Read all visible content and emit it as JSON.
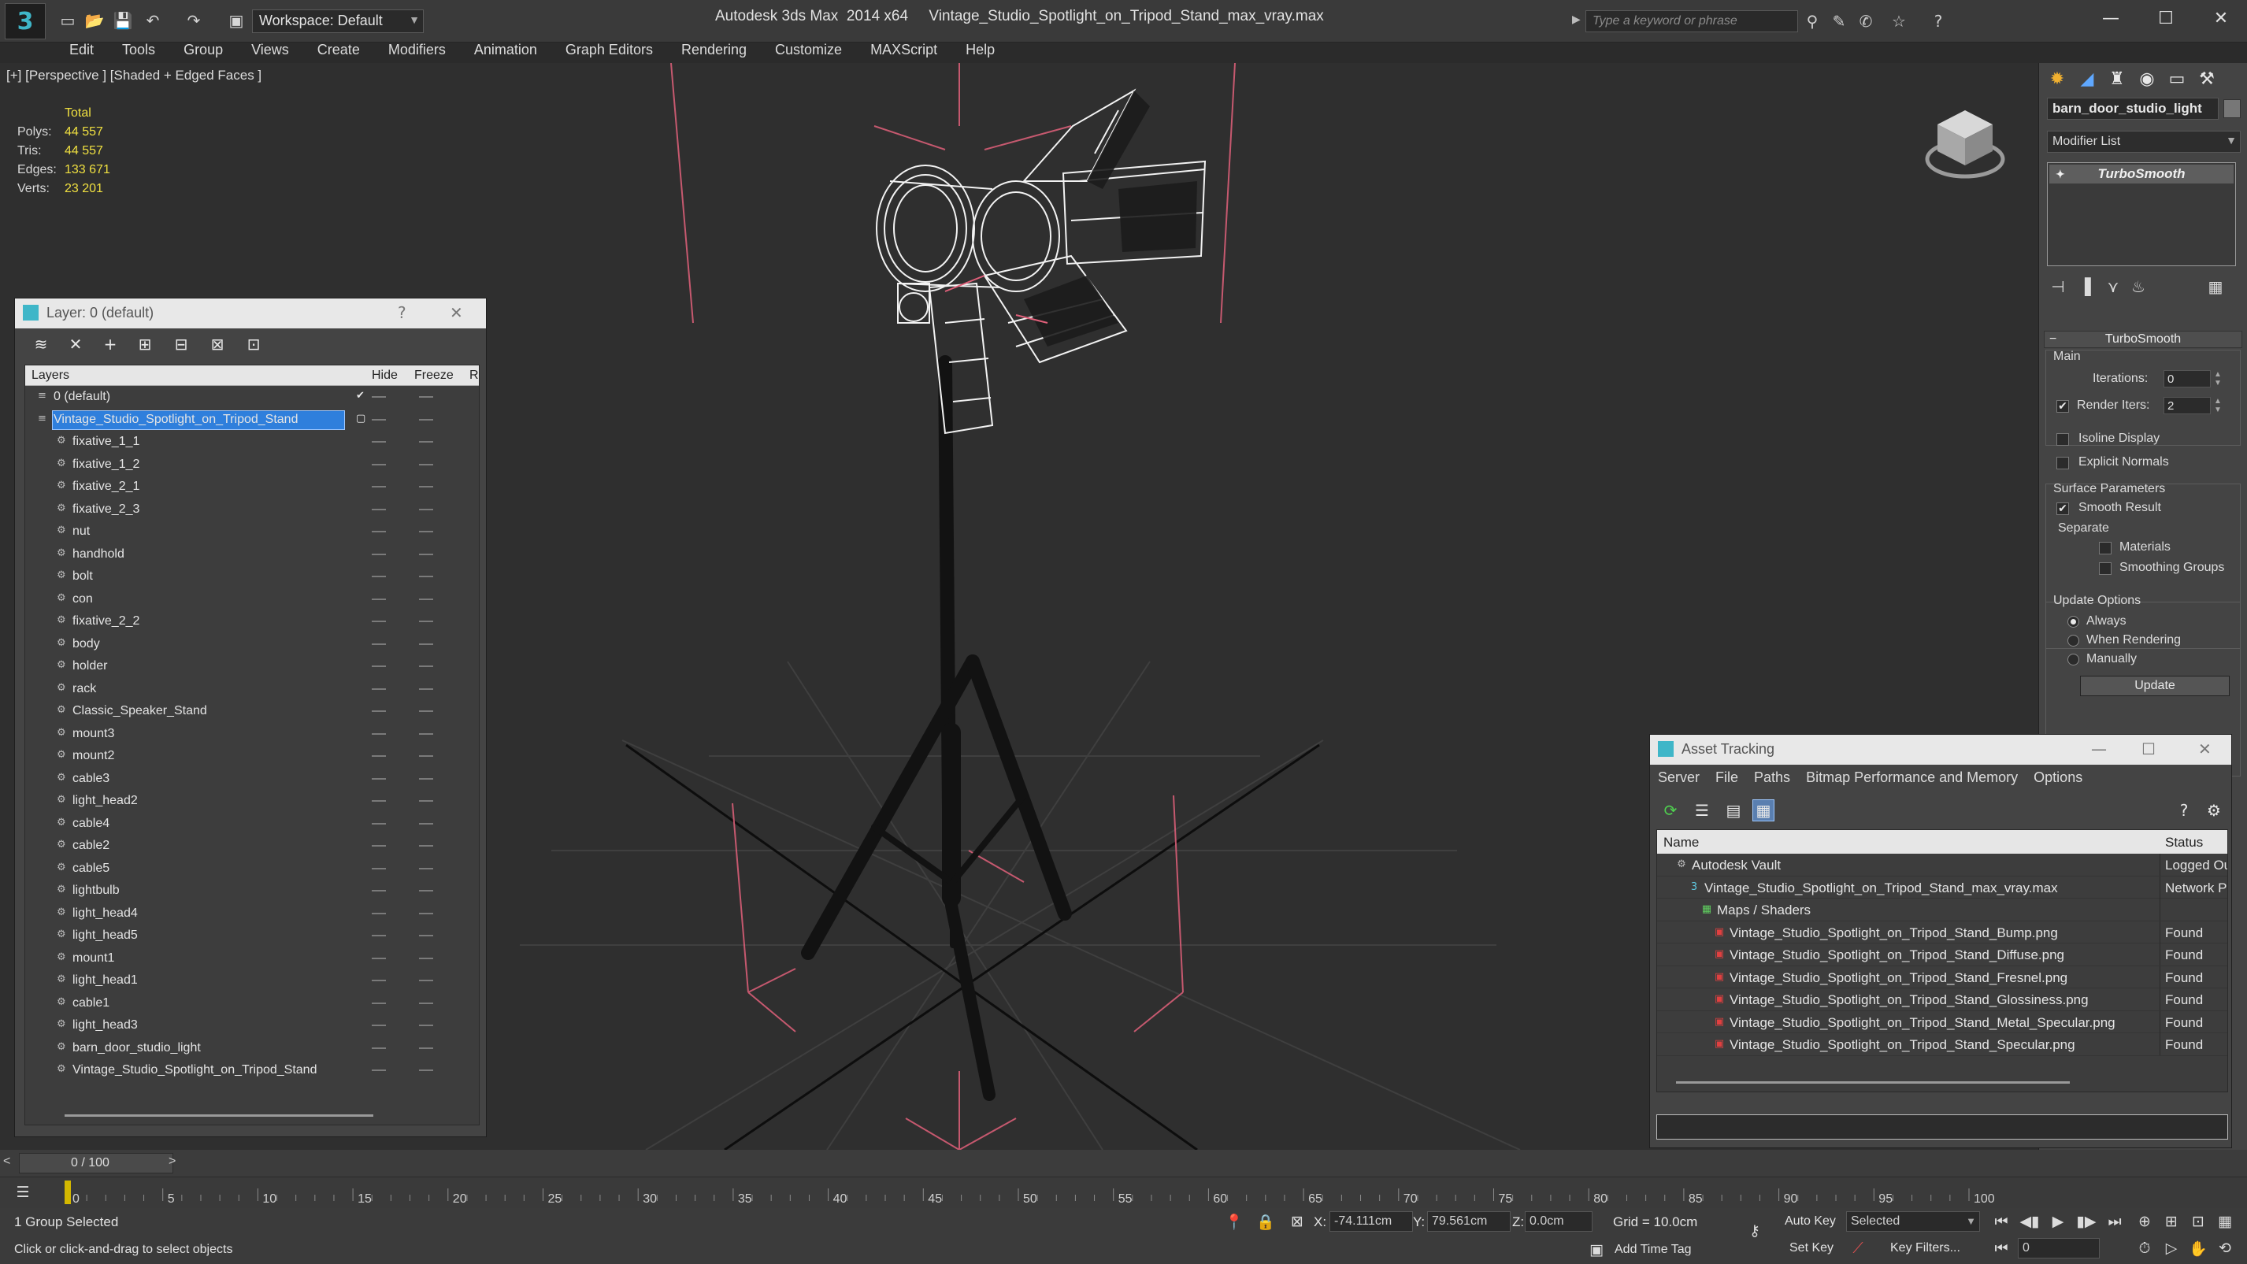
{
  "titlebar": {
    "workspace": "Workspace: Default",
    "app_title": "Autodesk 3ds Max  2014 x64     Vintage_Studio_Spotlight_on_Tripod_Stand_max_vray.max",
    "search_placeholder": "Type a keyword or phrase"
  },
  "menu": [
    "Edit",
    "Tools",
    "Group",
    "Views",
    "Create",
    "Modifiers",
    "Animation",
    "Graph Editors",
    "Rendering",
    "Customize",
    "MAXScript",
    "Help"
  ],
  "viewport": {
    "label": "[+] [Perspective ] [Shaded + Edged Faces ]",
    "stats": {
      "header": "Total",
      "polys_label": "Polys:",
      "polys": "44 557",
      "tris_label": "Tris:",
      "tris": "44 557",
      "edges_label": "Edges:",
      "edges": "133 671",
      "verts_label": "Verts:",
      "verts": "23 201"
    }
  },
  "layer_dialog": {
    "title": "Layer: 0 (default)",
    "help": "?",
    "close": "✕",
    "col_layers": "Layers",
    "col_hide": "Hide",
    "col_freeze": "Freeze",
    "col_more": "R",
    "rows": [
      {
        "name": "0 (default)",
        "level": 0,
        "type": "layer",
        "active": true
      },
      {
        "name": "Vintage_Studio_Spotlight_on_Tripod_Stand",
        "level": 0,
        "type": "layer",
        "selected": true
      },
      {
        "name": "fixative_1_1",
        "level": 1,
        "type": "object"
      },
      {
        "name": "fixative_1_2",
        "level": 1,
        "type": "object"
      },
      {
        "name": "fixative_2_1",
        "level": 1,
        "type": "object"
      },
      {
        "name": "fixative_2_3",
        "level": 1,
        "type": "object"
      },
      {
        "name": "nut",
        "level": 1,
        "type": "object"
      },
      {
        "name": "handhold",
        "level": 1,
        "type": "object"
      },
      {
        "name": "bolt",
        "level": 1,
        "type": "object"
      },
      {
        "name": "con",
        "level": 1,
        "type": "object"
      },
      {
        "name": "fixative_2_2",
        "level": 1,
        "type": "object"
      },
      {
        "name": "body",
        "level": 1,
        "type": "object"
      },
      {
        "name": "holder",
        "level": 1,
        "type": "object"
      },
      {
        "name": "rack",
        "level": 1,
        "type": "object"
      },
      {
        "name": "Classic_Speaker_Stand",
        "level": 1,
        "type": "object"
      },
      {
        "name": "mount3",
        "level": 1,
        "type": "object"
      },
      {
        "name": "mount2",
        "level": 1,
        "type": "object"
      },
      {
        "name": "cable3",
        "level": 1,
        "type": "object"
      },
      {
        "name": "light_head2",
        "level": 1,
        "type": "object"
      },
      {
        "name": "cable4",
        "level": 1,
        "type": "object"
      },
      {
        "name": "cable2",
        "level": 1,
        "type": "object"
      },
      {
        "name": "cable5",
        "level": 1,
        "type": "object"
      },
      {
        "name": "lightbulb",
        "level": 1,
        "type": "object"
      },
      {
        "name": "light_head4",
        "level": 1,
        "type": "object"
      },
      {
        "name": "light_head5",
        "level": 1,
        "type": "object"
      },
      {
        "name": "mount1",
        "level": 1,
        "type": "object"
      },
      {
        "name": "light_head1",
        "level": 1,
        "type": "object"
      },
      {
        "name": "cable1",
        "level": 1,
        "type": "object"
      },
      {
        "name": "light_head3",
        "level": 1,
        "type": "object"
      },
      {
        "name": "barn_door_studio_light",
        "level": 1,
        "type": "object"
      },
      {
        "name": "Vintage_Studio_Spotlight_on_Tripod_Stand",
        "level": 1,
        "type": "object"
      }
    ]
  },
  "command_panel": {
    "object_name": "barn_door_studio_light",
    "modifier_list": "Modifier List",
    "stack_item": "TurboSmooth",
    "rollout_title": "TurboSmooth",
    "main_label": "Main",
    "iterations_label": "Iterations:",
    "iterations": "0",
    "render_iters_label": "Render Iters:",
    "render_iters": "2",
    "isoline_label": "Isoline Display",
    "explicit_normals_label": "Explicit Normals",
    "surface_params_label": "Surface Parameters",
    "smooth_result_label": "Smooth Result",
    "separate_label": "Separate",
    "materials_label": "Materials",
    "smoothing_groups_label": "Smoothing Groups",
    "update_options_label": "Update Options",
    "always_label": "Always",
    "when_rendering_label": "When Rendering",
    "manually_label": "Manually",
    "update_button": "Update"
  },
  "asset_tracking": {
    "title": "Asset Tracking",
    "menu": [
      "Server",
      "File",
      "Paths",
      "Bitmap Performance and Memory",
      "Options"
    ],
    "col_name": "Name",
    "col_status": "Status",
    "rows": [
      {
        "name": "Autodesk Vault",
        "status": "Logged Ou",
        "level": 0,
        "icon": "vault"
      },
      {
        "name": "Vintage_Studio_Spotlight_on_Tripod_Stand_max_vray.max",
        "status": "Network P",
        "level": 1,
        "icon": "max"
      },
      {
        "name": "Maps / Shaders",
        "status": "",
        "level": 2,
        "icon": "maps"
      },
      {
        "name": "Vintage_Studio_Spotlight_on_Tripod_Stand_Bump.png",
        "status": "Found",
        "level": 3,
        "icon": "png"
      },
      {
        "name": "Vintage_Studio_Spotlight_on_Tripod_Stand_Diffuse.png",
        "status": "Found",
        "level": 3,
        "icon": "png"
      },
      {
        "name": "Vintage_Studio_Spotlight_on_Tripod_Stand_Fresnel.png",
        "status": "Found",
        "level": 3,
        "icon": "png"
      },
      {
        "name": "Vintage_Studio_Spotlight_on_Tripod_Stand_Glossiness.png",
        "status": "Found",
        "level": 3,
        "icon": "png"
      },
      {
        "name": "Vintage_Studio_Spotlight_on_Tripod_Stand_Metal_Specular.png",
        "status": "Found",
        "level": 3,
        "icon": "png"
      },
      {
        "name": "Vintage_Studio_Spotlight_on_Tripod_Stand_Specular.png",
        "status": "Found",
        "level": 3,
        "icon": "png"
      }
    ]
  },
  "timeline": {
    "position": "0 / 100",
    "ticks": [
      "0",
      "5",
      "10",
      "15",
      "20",
      "25",
      "30",
      "35",
      "40",
      "45",
      "50",
      "55",
      "60",
      "65",
      "70",
      "75",
      "80",
      "85",
      "90",
      "95",
      "100"
    ]
  },
  "statusbar": {
    "selection": "1 Group Selected",
    "prompt": "Click or click-and-drag to select objects",
    "x_label": "X:",
    "x": "-74.111cm",
    "y_label": "Y:",
    "y": "79.561cm",
    "z_label": "Z:",
    "z": "0.0cm",
    "grid": "Grid = 10.0cm",
    "add_time_tag": "Add Time Tag",
    "auto_key": "Auto Key",
    "set_key": "Set Key",
    "selected_dd": "Selected",
    "key_filters": "Key Filters...",
    "frame": "0"
  },
  "colors": {
    "accent": "#3fb6c8",
    "selection_blue": "#2f7fdc",
    "stats_yellow": "#f0e040",
    "bbox_pink": "#e0607a",
    "timeline_marker": "#d4b800"
  }
}
